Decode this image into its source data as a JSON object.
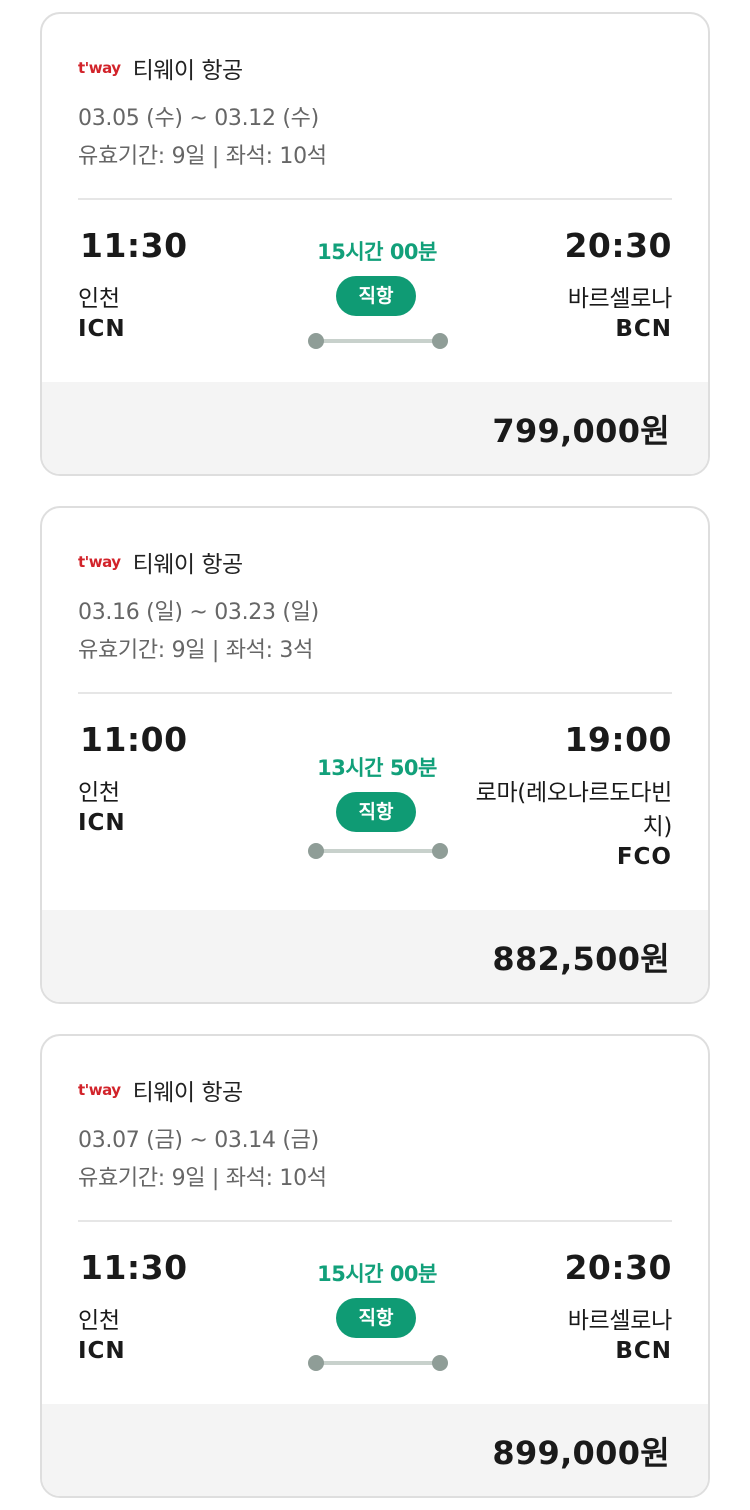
{
  "flights": [
    {
      "logo_text": "t'way",
      "airline": "티웨이 항공",
      "dates": "03.05 (수) ~ 03.12 (수)",
      "meta": "유효기간: 9일 | 좌석: 10석",
      "departure": {
        "time": "11:30",
        "city": "인천",
        "code": "ICN"
      },
      "arrival": {
        "time": "20:30",
        "city": "바르셀로나",
        "code": "BCN"
      },
      "duration": "15시간 00분",
      "badge": "직항",
      "price": "799,000원"
    },
    {
      "logo_text": "t'way",
      "airline": "티웨이 항공",
      "dates": "03.16 (일) ~ 03.23 (일)",
      "meta": "유효기간: 9일 | 좌석: 3석",
      "departure": {
        "time": "11:00",
        "city": "인천",
        "code": "ICN"
      },
      "arrival": {
        "time": "19:00",
        "city": "로마(레오나르도다빈치)",
        "code": "FCO"
      },
      "duration": "13시간 50분",
      "badge": "직항",
      "price": "882,500원"
    },
    {
      "logo_text": "t'way",
      "airline": "티웨이 항공",
      "dates": "03.07 (금) ~ 03.14 (금)",
      "meta": "유효기간: 9일 | 좌석: 10석",
      "departure": {
        "time": "11:30",
        "city": "인천",
        "code": "ICN"
      },
      "arrival": {
        "time": "20:30",
        "city": "바르셀로나",
        "code": "BCN"
      },
      "duration": "15시간 00분",
      "badge": "직항",
      "price": "899,000원"
    }
  ],
  "colors": {
    "accent_green": "#0f9b74",
    "duration_green": "#12a07a",
    "brand_red": "#d2232a",
    "price_bar_bg": "#f4f4f4"
  },
  "icons": [
    "tway-logo",
    "route-dot",
    "route-line"
  ]
}
